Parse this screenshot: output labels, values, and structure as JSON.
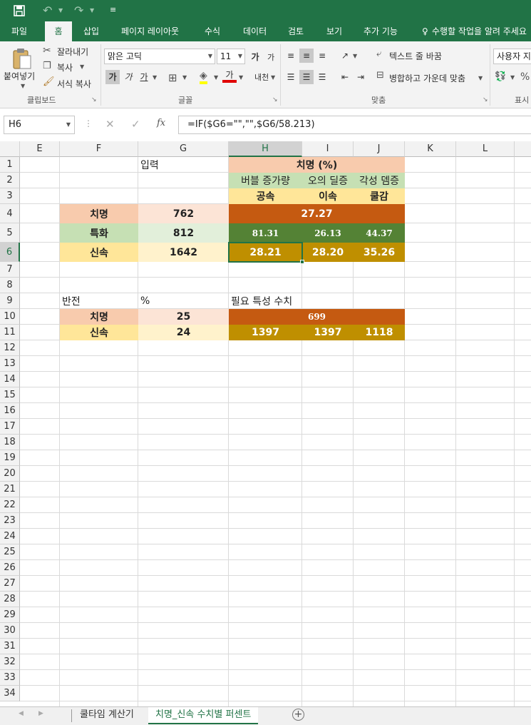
{
  "quick_access": {
    "save_icon": "save-icon",
    "undo_icon": "undo-icon",
    "redo_icon": "redo-icon",
    "customize_icon": "customize-qat-icon"
  },
  "tabs": [
    "파일",
    "홈",
    "삽입",
    "페이지 레이아웃",
    "수식",
    "데이터",
    "검토",
    "보기",
    "추가 기능"
  ],
  "active_tab": "홈",
  "tell_me": "수행할 작업을 알려 주세요",
  "ribbon": {
    "clipboard": {
      "paste": "붙여넣기",
      "cut": "잘라내기",
      "copy": "복사",
      "format_painter": "서식 복사",
      "group": "클립보드"
    },
    "font": {
      "name": "맑은 고딕",
      "size": "11",
      "grow": "가",
      "shrink": "가",
      "bold": "가",
      "italic": "가",
      "underline": "가",
      "font_color": "가",
      "phonetic": "내천",
      "group": "글꼴"
    },
    "alignment": {
      "wrap": "텍스트 줄 바꿈",
      "merge": "병합하고 가운데 맞춤",
      "group": "맞춤"
    },
    "number": {
      "format": "사용자 지정",
      "group": "표시"
    }
  },
  "formula_bar": {
    "name_box": "H6",
    "cancel": "✕",
    "enter": "✓",
    "fx": "fx",
    "formula": "=IF($G6=\"\",\"\",$G6/58.213)"
  },
  "columns": [
    "E",
    "F",
    "G",
    "H",
    "I",
    "J",
    "K",
    "L"
  ],
  "selected_column": "H",
  "selected_row": "6",
  "rows": [
    "1",
    "2",
    "3",
    "4",
    "5",
    "6",
    "7",
    "8",
    "9",
    "10",
    "11",
    "12",
    "13",
    "14",
    "15",
    "16",
    "17",
    "18",
    "19",
    "20",
    "21",
    "22",
    "23",
    "24",
    "25",
    "26",
    "27",
    "28",
    "29",
    "30",
    "31",
    "32",
    "33",
    "34"
  ],
  "cells": {
    "G1": "입력",
    "H1": "치명 (%)",
    "H2": "버블 증가량",
    "I2": "오의 딜증",
    "J2": "각성 뎀증",
    "H3": "공속",
    "I3": "이속",
    "J3": "쿨감",
    "F4": "치명",
    "G4": "762",
    "H4": "27.27",
    "F5": "특화",
    "G5": "812",
    "H5": "81.31",
    "I5": "26.13",
    "J5": "44.37",
    "F6": "신속",
    "G6": "1642",
    "H6": "28.21",
    "I6": "28.20",
    "J6": "35.26",
    "F9": "반전",
    "G9": "%",
    "H9": "필요 특성 수치",
    "F10": "치명",
    "G10": "25",
    "H10": "699",
    "F11": "신속",
    "G11": "24",
    "H11": "1397",
    "I11": "1397",
    "J11": "1118"
  },
  "colors": {
    "header_salmon": "#f8cbad",
    "header_green": "#c6e0b4",
    "header_yellow": "#ffe699",
    "light_salmon": "#fce4d6",
    "light_green": "#e2efda",
    "light_yellow": "#fff2cc",
    "orange": "#c55a11",
    "green": "#548235",
    "gold": "#bf8f00",
    "excel_green": "#217346"
  },
  "sheets": [
    "쿨타임 계산기",
    "치명_신속 수치별 퍼센트"
  ],
  "active_sheet": "치명_신속 수치별 퍼센트"
}
